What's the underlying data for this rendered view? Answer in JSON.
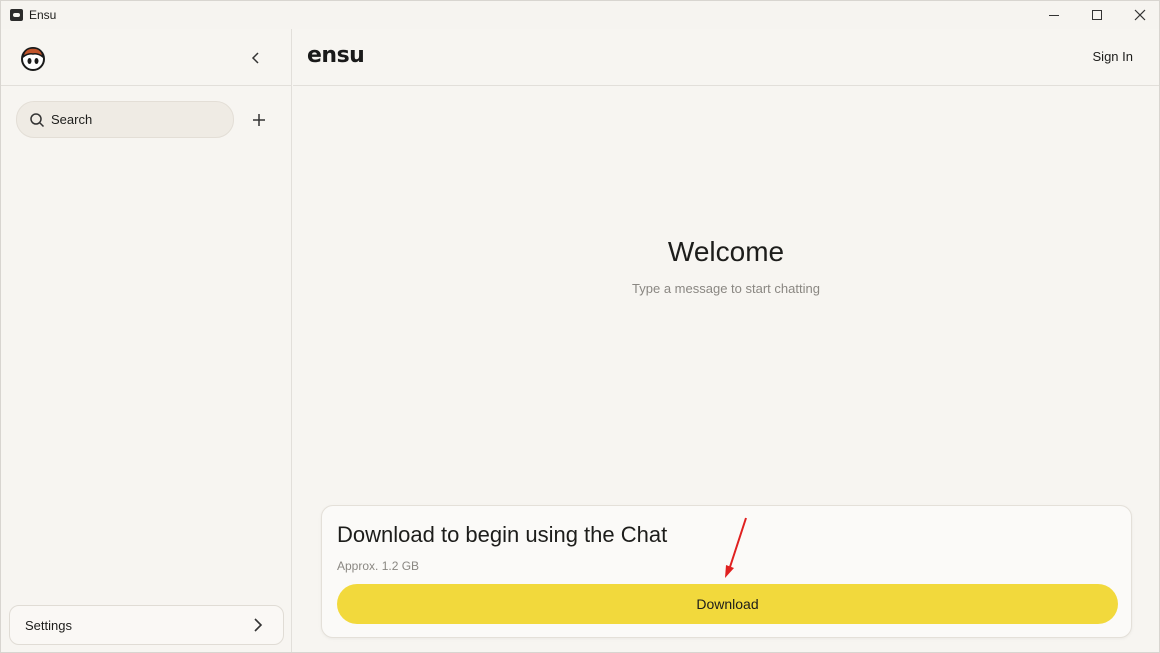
{
  "window": {
    "title": "Ensu"
  },
  "sidebar": {
    "search_placeholder": "Search",
    "settings_label": "Settings"
  },
  "header": {
    "brand": "ensu",
    "sign_in": "Sign In"
  },
  "main": {
    "welcome_title": "Welcome",
    "welcome_subtitle": "Type a message to start chatting"
  },
  "download_card": {
    "title": "Download to begin using the Chat",
    "size": "Approx. 1.2 GB",
    "button_label": "Download"
  },
  "colors": {
    "accent": "#f2d93c",
    "background": "#f7f5f1",
    "annotation_arrow": "#e02020"
  },
  "icons": [
    "app-icon",
    "ensu-logo-icon",
    "chevron-left-icon",
    "search-icon",
    "plus-icon",
    "chevron-right-icon",
    "minimize-icon",
    "maximize-icon",
    "close-icon"
  ]
}
